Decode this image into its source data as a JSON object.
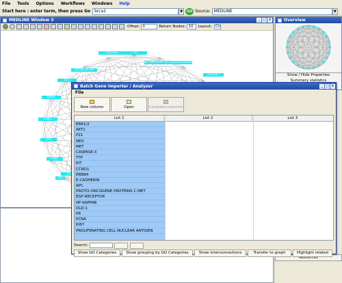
{
  "menu": [
    "File",
    "Tools",
    "Options",
    "Workflows",
    "Windows",
    "Help"
  ],
  "startbar": {
    "label": "Start here : enter term, then press ",
    "go_word": "Go",
    "query": "brca1",
    "go_button": "GO",
    "source_label": "Source:",
    "source_value": "MEDLINE"
  },
  "medline_window": {
    "title": "MEDLINE Window 3",
    "offset_label": "Offset:",
    "offset_value": "0",
    "return_nodes_label": "Return Nodes:",
    "return_nodes_value": "10",
    "layout_label": "Layout:",
    "layout_value": "Circular",
    "layout2_value": "SmartOrganic"
  },
  "graph_nodes": [
    "ER-ALPHA",
    "KIT",
    "EGF-RECEPTOR",
    "INFLAMMATORY CELL NUCLEAR ANTIGEN",
    "AKT1",
    "CASPASE-3",
    "BRBB4",
    "CCND1",
    "APC",
    "PCNA",
    "P21",
    "CD9"
  ],
  "overview": {
    "title": "Overview",
    "show_hide": "Show / Hide Properties",
    "summary": "Summary statistics",
    "resources": "Resources"
  },
  "dialog": {
    "title": "Batch Gene Importer / Analyzer",
    "menu": "File",
    "toolbar": {
      "new_column": "New column",
      "open": "Open",
      "compare": "Compare columns"
    },
    "columns": [
      "List 1",
      "List 2",
      "List 3"
    ],
    "list1": [
      "ERK1/2",
      "AKT1",
      "P21",
      "NEU",
      "MET",
      "CASPASE-3",
      "TTP",
      "KIT",
      "CCND1",
      "ERBB4",
      "E-CADHERIN",
      "APC",
      "PROTO-ONCOGENE PROTEINS C-MET",
      "EGF-RECEPTOR",
      "NF-KAPPAB",
      "DLD-1",
      "PR",
      "PCNA",
      "KI67",
      "PROLIFERATING CELL NUCLEAR ANTIGEN"
    ],
    "search_label": "Search:",
    "actions": {
      "go_categories": "Show GO Categories",
      "grouping": "Show grouping by GO Categories",
      "interconnections": "Show Interconnections",
      "transfer": "Transfer to graph",
      "highlight": "Highlight related"
    }
  },
  "colors": {
    "title_bar": "#2b58b8",
    "node": "#24e8f0",
    "list_highlight": "#9fcaf7",
    "go_button": "#3ba23b"
  }
}
